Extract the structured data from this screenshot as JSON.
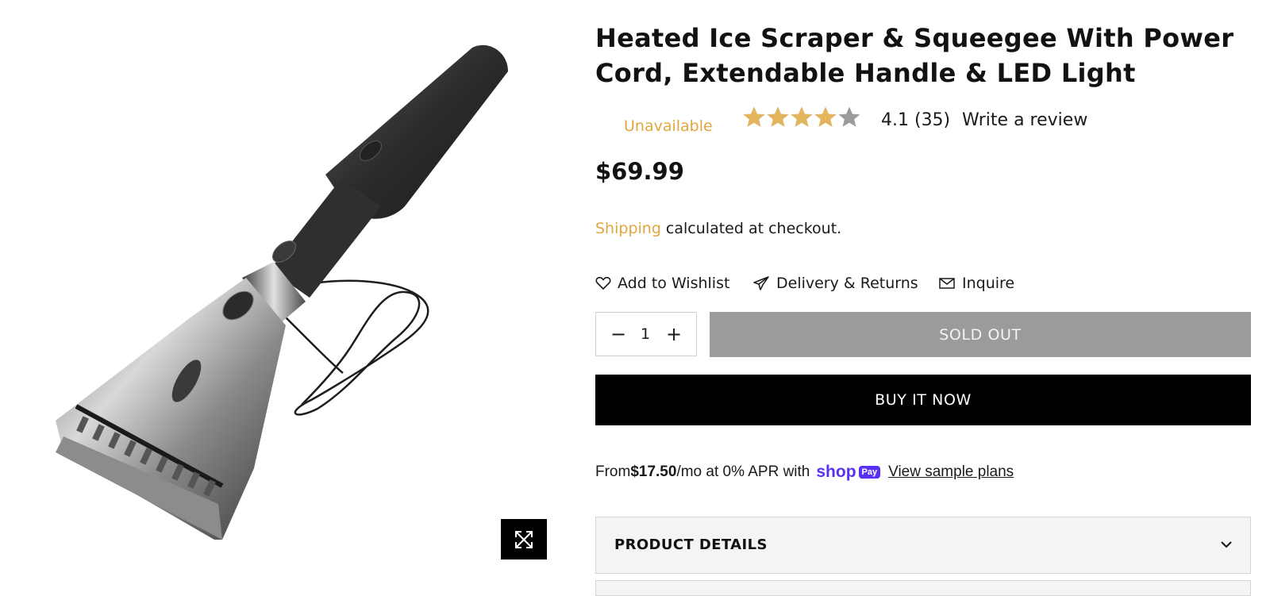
{
  "product": {
    "title": "Heated Ice Scraper & Squeegee With Power Cord, Extendable Handle & LED Light",
    "availability": "Unavailable",
    "rating": 4.1,
    "rating_text": "4.1 (35)",
    "write_review": "Write a review",
    "price": "$69.99",
    "shipping_link": "Shipping",
    "shipping_rest": " calculated at checkout."
  },
  "actions": {
    "wishlist": "Add to Wishlist",
    "delivery": "Delivery & Returns",
    "inquire": "Inquire"
  },
  "quantity": {
    "value": "1",
    "minus": "−",
    "plus": "+"
  },
  "buttons": {
    "sold_out": "SOLD OUT",
    "buy_now": "BUY IT NOW"
  },
  "installments": {
    "prefix": "From ",
    "amount": "$17.50",
    "suffix": "/mo at 0% APR with",
    "shoppay_text": "shop",
    "shoppay_pill": "Pay",
    "view_plans": "View sample plans"
  },
  "accordion": {
    "title": "PRODUCT DETAILS"
  },
  "colors": {
    "accent": "#e3a63e",
    "star_filled": "#e3b65d",
    "star_empty": "#9b9b9b",
    "sold_out_bg": "#9b9b9b",
    "shoppay": "#5a31f4"
  },
  "icons": {
    "zoom": "expand-arrows-icon",
    "wishlist": "heart-icon",
    "delivery": "paper-plane-icon",
    "inquire": "envelope-icon",
    "accordion": "chevron-down-icon"
  }
}
